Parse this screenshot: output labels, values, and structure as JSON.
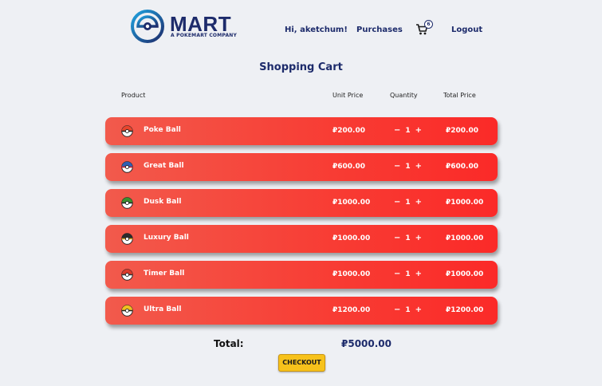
{
  "header": {
    "logo_text": "MART",
    "logo_subtitle": "A POKEMART COMPANY",
    "greeting": "Hi, ",
    "username": "aketchum!",
    "purchases": "Purchases",
    "cart_count": "6",
    "logout": "Logout"
  },
  "page_title": "Shopping Cart",
  "columns": {
    "product": "Product",
    "unit_price": "Unit Price",
    "quantity": "Quantity",
    "total_price": "Total Price"
  },
  "qty_controls": {
    "minus": "−",
    "plus": "+"
  },
  "items": [
    {
      "name": "Poke Ball",
      "unit_price": "₽200.00",
      "quantity": "1",
      "total": "₽200.00",
      "ball_top": "#e8452c",
      "ball_band": "#222222"
    },
    {
      "name": "Great Ball",
      "unit_price": "₽600.00",
      "quantity": "1",
      "total": "₽600.00",
      "ball_top": "#2f5fb3",
      "ball_band": "#c0202a"
    },
    {
      "name": "Dusk Ball",
      "unit_price": "₽1000.00",
      "quantity": "1",
      "total": "₽1000.00",
      "ball_top": "#3a8f2e",
      "ball_band": "#222222"
    },
    {
      "name": "Luxury Ball",
      "unit_price": "₽1000.00",
      "quantity": "1",
      "total": "₽1000.00",
      "ball_top": "#2b2b2b",
      "ball_band": "#d9a520"
    },
    {
      "name": "Timer Ball",
      "unit_price": "₽1000.00",
      "quantity": "1",
      "total": "₽1000.00",
      "ball_top": "#d93a2a",
      "ball_band": "#333333"
    },
    {
      "name": "Ultra Ball",
      "unit_price": "₽1200.00",
      "quantity": "1",
      "total": "₽1200.00",
      "ball_top": "#f0c020",
      "ball_band": "#222222"
    }
  ],
  "summary": {
    "total_label": "Total:",
    "total_value": "₽5000.00",
    "checkout": "CHECKOUT"
  }
}
